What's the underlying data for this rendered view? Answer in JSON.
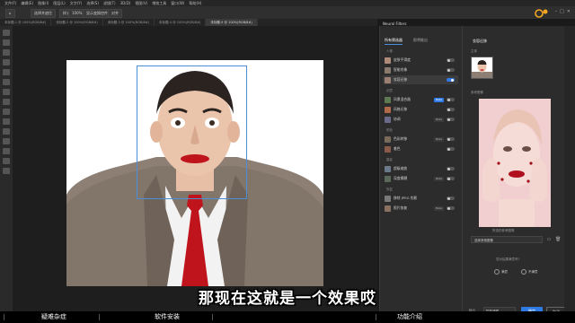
{
  "menubar": {
    "items": [
      "文件(F)",
      "编辑(E)",
      "图像(I)",
      "图层(L)",
      "文字(Y)",
      "选择(S)",
      "滤镜(T)",
      "3D(D)",
      "视图(V)",
      "增效工具",
      "窗口(W)",
      "帮助(H)"
    ]
  },
  "options_bar": {
    "chips": [
      "选择并遮住",
      "样式",
      "100%",
      "显示变换控件",
      "对齐"
    ]
  },
  "doc_tabs": [
    "未标题-1 @ 100%(RGB/8#)",
    "未标题-2 @ 100%(RGB/8#)",
    "未标题-3 @ 100%(RGB/8#)",
    "未标题-4 @ 100%(RGB/8#)",
    "未标题-5 @ 100%(RGB/8#)"
  ],
  "neural_filters": {
    "panel_title": "Neural Filters",
    "tabs": [
      "所有筛选器",
      "即将推出"
    ],
    "sections": [
      {
        "label": "人像",
        "items": [
          {
            "label": "皮肤平滑度",
            "toggle_on": false,
            "badge": ""
          },
          {
            "label": "智能肖像",
            "toggle_on": false,
            "badge": ""
          },
          {
            "label": "妆容迁移",
            "toggle_on": true,
            "badge": ""
          }
        ]
      },
      {
        "label": "创意",
        "items": [
          {
            "label": "风景混合器",
            "toggle_on": false,
            "badge": "Beta"
          },
          {
            "label": "风格迁移",
            "toggle_on": false,
            "badge": ""
          },
          {
            "label": "协调",
            "toggle_on": false,
            "badge": "Beta"
          }
        ]
      },
      {
        "label": "颜色",
        "items": [
          {
            "label": "色彩转移",
            "toggle_on": false,
            "badge": "Beta"
          },
          {
            "label": "着色",
            "toggle_on": false,
            "badge": ""
          }
        ]
      },
      {
        "label": "摄影",
        "items": [
          {
            "label": "超级缩放",
            "toggle_on": false,
            "badge": ""
          },
          {
            "label": "深度模糊",
            "toggle_on": false,
            "badge": "Beta"
          }
        ]
      },
      {
        "label": "恢复",
        "items": [
          {
            "label": "移除 JPEG 伪影",
            "toggle_on": false,
            "badge": ""
          },
          {
            "label": "照片恢复",
            "toggle_on": false,
            "badge": "Beta"
          }
        ]
      }
    ]
  },
  "makeup_panel": {
    "title": "妆容迁移",
    "subject_label": "主体",
    "reference_label": "参考图像",
    "source_note": "所选的参考图像",
    "select_placeholder": "选择其他图像",
    "question": "您对结果满意吗?",
    "yes_label": "满意",
    "no_label": "不满意",
    "output_label": "输出",
    "output_value": "智能滤镜",
    "ok_label": "确定",
    "cancel_label": "取消"
  },
  "subtitle": "那现在这就是一个效果哎",
  "taskbar": {
    "items": [
      "疑难杂症",
      "软件安装",
      "功能介绍"
    ]
  },
  "colors": {
    "accent": "#2f7ae5",
    "panel": "#2c2c2c",
    "lipstick": "#c0141d",
    "tie": "#c0141d",
    "brand": "#f5a623"
  }
}
